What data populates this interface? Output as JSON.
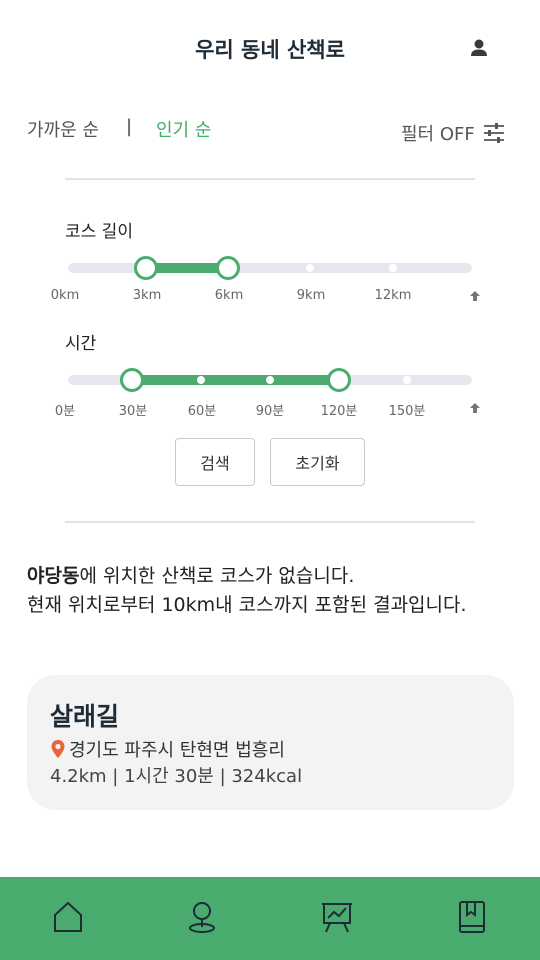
{
  "header": {
    "title": "우리 동네 산책로",
    "profile_icon": "user-icon"
  },
  "sort": {
    "nearest_label": "가까운 순",
    "separator": "|",
    "popular_label": "인기 순",
    "active": "popular",
    "active_color": "#3fae68"
  },
  "filter": {
    "label": "필터 OFF",
    "icon": "sliders-icon"
  },
  "distance_filter": {
    "title": "코스 길이",
    "ticks": [
      "0km",
      "3km",
      "6km",
      "9km",
      "12km"
    ],
    "selected_min": "3km",
    "selected_max": "6km",
    "expand_icon": "arrow-up-icon"
  },
  "time_filter": {
    "title": "시간",
    "ticks": [
      "0분",
      "30분",
      "60분",
      "90분",
      "120분",
      "150분"
    ],
    "selected_min": "30분",
    "selected_max": "120분",
    "expand_icon": "arrow-up-icon"
  },
  "buttons": {
    "search": "검색",
    "reset": "초기화"
  },
  "notice": {
    "location": "야당동",
    "line1_rest": "에 위치한 산책로 코스가 없습니다.",
    "line2": "현재 위치로부터 10km내 코스까지 포함된 결과입니다."
  },
  "results": [
    {
      "name": "살래길",
      "address": "경기도 파주시 탄현면 법흥리",
      "stats": "4.2km | 1시간 30분 | 324kcal",
      "pin_icon": "location-pin-icon"
    }
  ],
  "bottom_nav": {
    "items": [
      "home-icon",
      "map-pin-icon",
      "presentation-chart-icon",
      "bookmark-book-icon"
    ],
    "background": "#4aab6f"
  },
  "colors": {
    "accent": "#4aab6f",
    "track": "#e6e7ee",
    "card_bg": "#f3f3f3",
    "pin": "#e8663d"
  }
}
